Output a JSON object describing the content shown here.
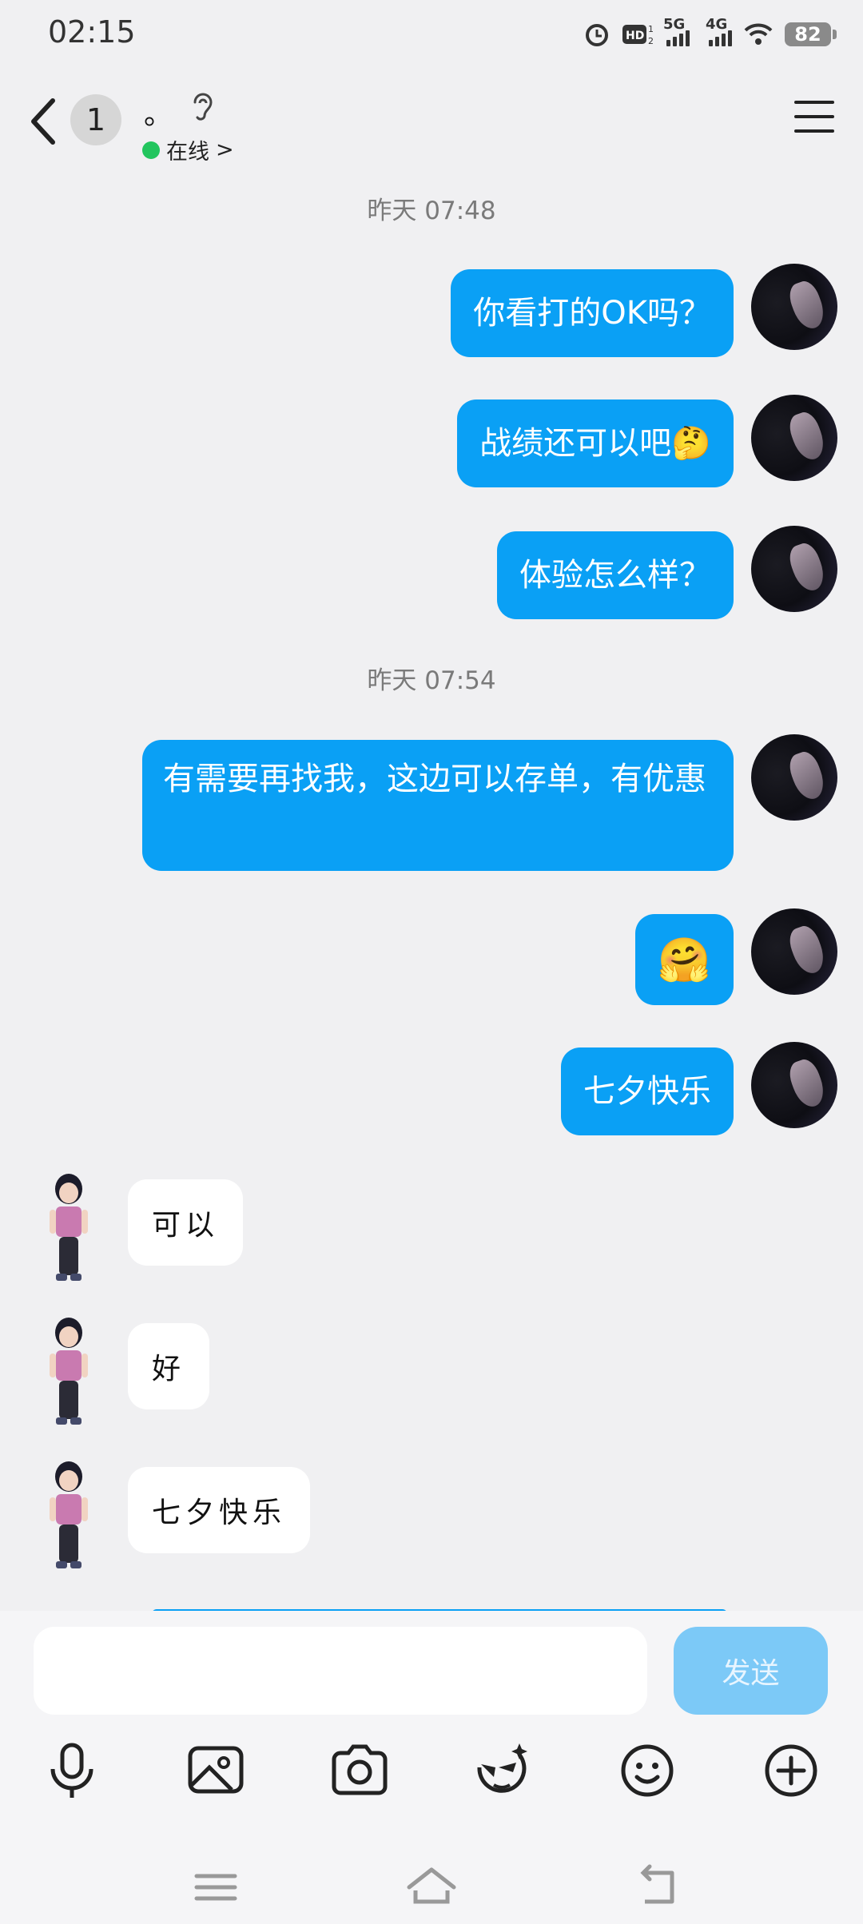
{
  "status_bar": {
    "time": "02:15",
    "battery": "82",
    "net1": "5G",
    "net2": "4G"
  },
  "header": {
    "back_label": "back",
    "avatar_text": "1",
    "name": "。",
    "status": "在线",
    "status_chevron": ">"
  },
  "messages": [
    {
      "type": "timestamp",
      "text": "昨天 07:48"
    },
    {
      "type": "out",
      "text": "你看打的OK吗？"
    },
    {
      "type": "out",
      "text": "战绩还可以吧🤔"
    },
    {
      "type": "out",
      "text": "体验怎么样？"
    },
    {
      "type": "timestamp",
      "text": "昨天 07:54"
    },
    {
      "type": "out",
      "text": "有需要再找我，这边可以存单，有优惠"
    },
    {
      "type": "out",
      "text": "🤗"
    },
    {
      "type": "out",
      "text": "七夕快乐"
    },
    {
      "type": "in",
      "text": "可以"
    },
    {
      "type": "in",
      "text": "好"
    },
    {
      "type": "in",
      "text": "七夕快乐"
    }
  ],
  "composer": {
    "send_label": "发送"
  },
  "toolbar_icons": [
    "microphone-icon",
    "image-icon",
    "camera-icon",
    "sticker-icon",
    "emoji-icon",
    "plus-icon"
  ],
  "nav_icons": [
    "menu-icon",
    "home-icon",
    "back-icon"
  ],
  "colors": {
    "accent": "#0aa0f5",
    "send_disabled": "#7cc9f7",
    "online": "#22c55e",
    "background": "#f0f0f2"
  }
}
